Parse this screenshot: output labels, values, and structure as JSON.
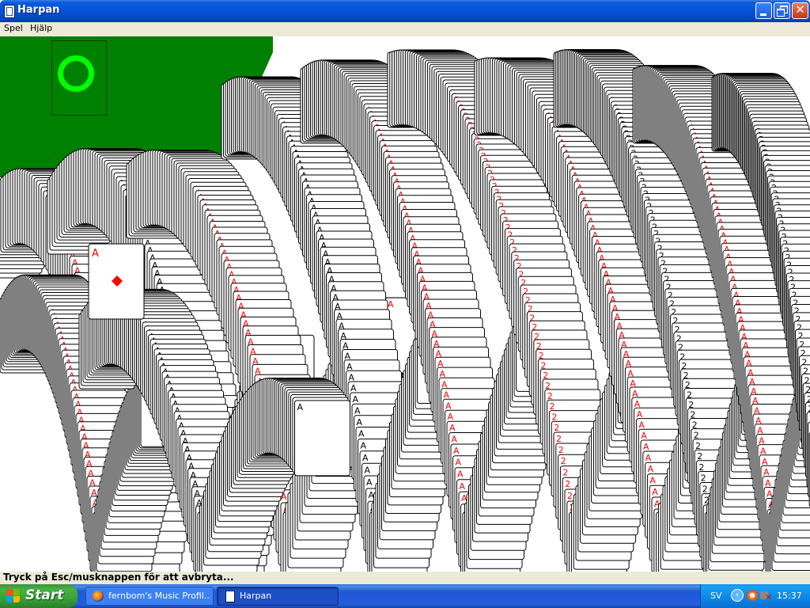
{
  "window": {
    "title": "Harpan"
  },
  "menu": {
    "items": [
      "Spel",
      "Hjälp"
    ]
  },
  "game": {
    "felt_color": "#008000",
    "restart_ring_color": "#00ff00",
    "red_suit_color": "#ff0000",
    "black_suit_color": "#000000",
    "visible_cards": [
      {
        "rank": "A",
        "suit": "diamonds",
        "icon": "diamond-suit-icon"
      },
      {
        "rank": "A",
        "suit": "spades",
        "icon": "spade-suit-icon"
      },
      {
        "rank": "A",
        "suit": "hearts",
        "icon": "heart-suit-icon"
      },
      {
        "rank": "2",
        "suit": "hearts",
        "icon": "heart-suit-icon"
      },
      {
        "rank": "2",
        "suit": "spades",
        "icon": "spade-suit-icon"
      }
    ]
  },
  "status": {
    "text": "Tryck på Esc/musknappen för att avbryta..."
  },
  "taskbar": {
    "start_label": "Start",
    "tasks": [
      {
        "label": "fernbom's Music Profil...",
        "icon": "firefox-icon",
        "active": false
      },
      {
        "label": "Harpan",
        "icon": "solitaire-icon",
        "active": true
      }
    ],
    "tray": {
      "language": "SV",
      "clock": "15:37"
    }
  }
}
